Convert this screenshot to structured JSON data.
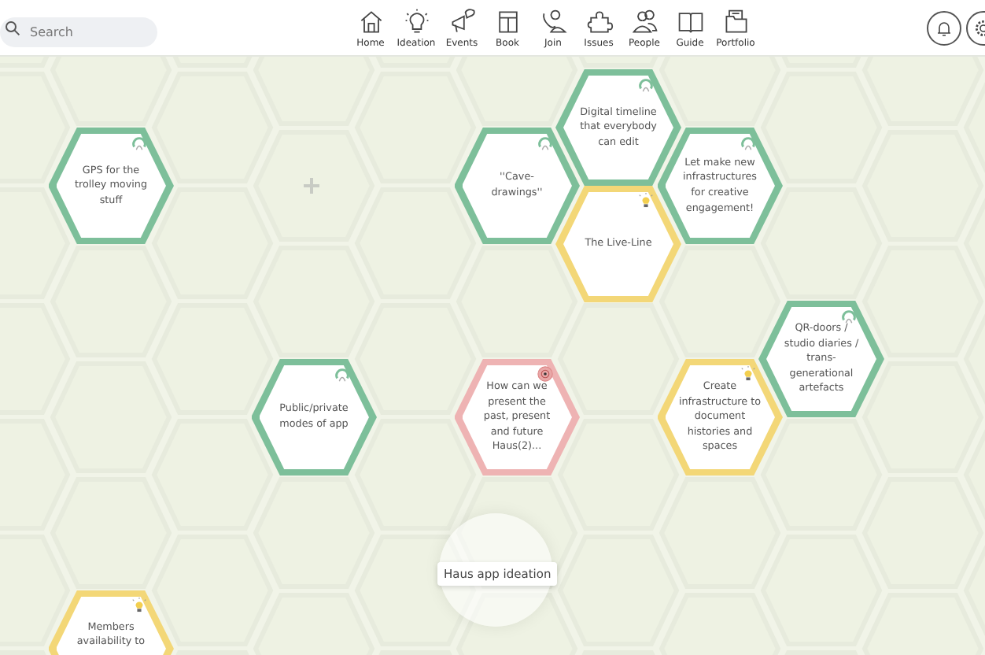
{
  "search": {
    "placeholder": "Search"
  },
  "nav": [
    {
      "label": "Home"
    },
    {
      "label": "Ideation"
    },
    {
      "label": "Events"
    },
    {
      "label": "Book"
    },
    {
      "label": "Join"
    },
    {
      "label": "Issues"
    },
    {
      "label": "People"
    },
    {
      "label": "Guide"
    },
    {
      "label": "Portfolio"
    }
  ],
  "ideas": [
    {
      "text": "Digital timeline that everybody can edit",
      "kind": "user",
      "color": "#7dbf9a"
    },
    {
      "text": "GPS for the trolley moving stuff",
      "kind": "user",
      "color": "#7dbf9a"
    },
    {
      "text": "''Cave-drawings''",
      "kind": "user",
      "color": "#7dbf9a"
    },
    {
      "text": "Let make new infrastructures for creative engagement!",
      "kind": "user",
      "color": "#7dbf9a"
    },
    {
      "text": "The Live-Line",
      "kind": "idea",
      "color": "#f3d777"
    },
    {
      "text": "QR-doors / studio diaries / trans-generational artefacts",
      "kind": "user",
      "color": "#7dbf9a"
    },
    {
      "text": "Public/private modes of app",
      "kind": "user",
      "color": "#7dbf9a"
    },
    {
      "text": "How can we present the past, present and future Haus(2)...",
      "kind": "issue",
      "color": "#eeb3b3"
    },
    {
      "text": "Create infrastructure to document histories and spaces",
      "kind": "idea",
      "color": "#f3d777"
    },
    {
      "text": "Members availability to",
      "kind": "idea",
      "color": "#f3d777"
    }
  ],
  "tooltip": "Haus app ideation"
}
